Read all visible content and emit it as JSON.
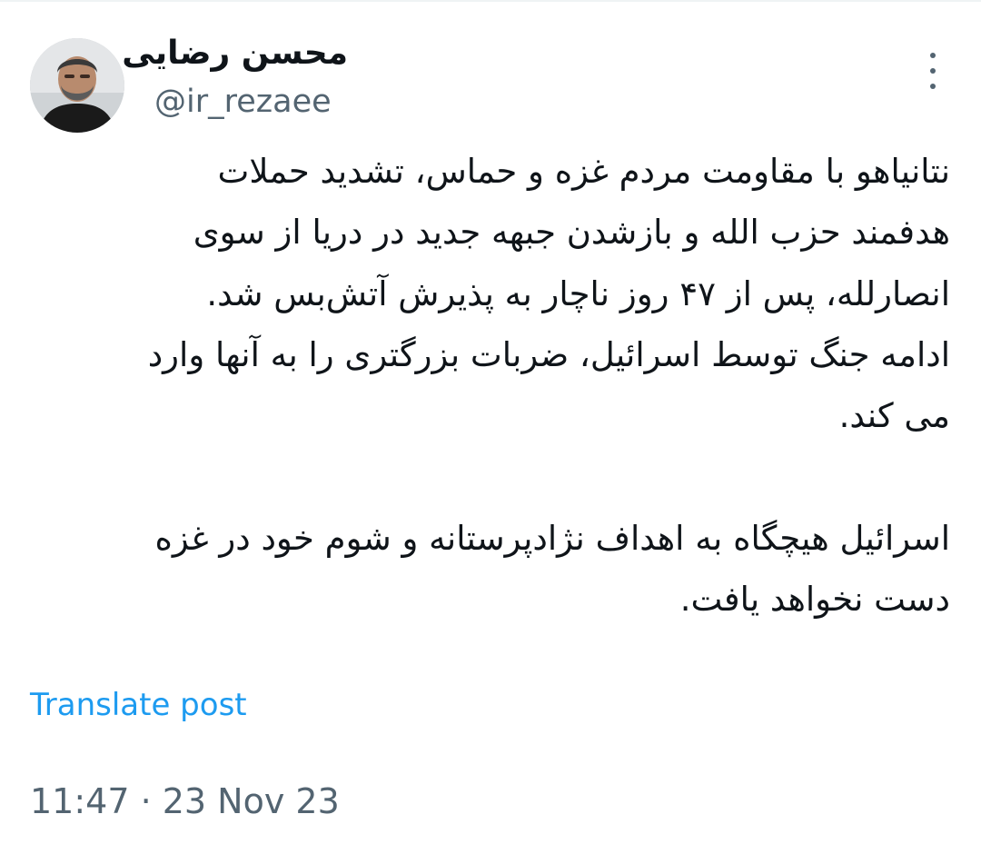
{
  "author": {
    "display_name": "محسن رضایی",
    "handle": "@ir_rezaee"
  },
  "tweet": {
    "paragraph1_lines": [
      "نتانیاهو با مقاومت مردم غزه و حماس، تشدید حملات",
      "هدفمند حزب الله و بازشدن جبهه جدید در دریا از سوی",
      "انصارلله، پس از ۴۷ روز ناچار به پذیرش آتش‌بس شد.",
      "ادامه جنگ توسط اسرائیل، ضربات بزرگتری را به آنها وارد",
      "می کند."
    ],
    "paragraph2_lines": [
      "اسرائیل هیچگاه به اهداف نژادپرستانه و شوم خود در غزه",
      "دست نخواهد یافت."
    ]
  },
  "translate_label": "Translate post",
  "timestamp": "11:47 · 23 Nov 23",
  "icons": {
    "more": "more-vertical-icon",
    "avatar": "profile-avatar"
  },
  "colors": {
    "link": "#1d9bf0",
    "secondary_text": "#536471",
    "primary_text": "#0f1419"
  }
}
